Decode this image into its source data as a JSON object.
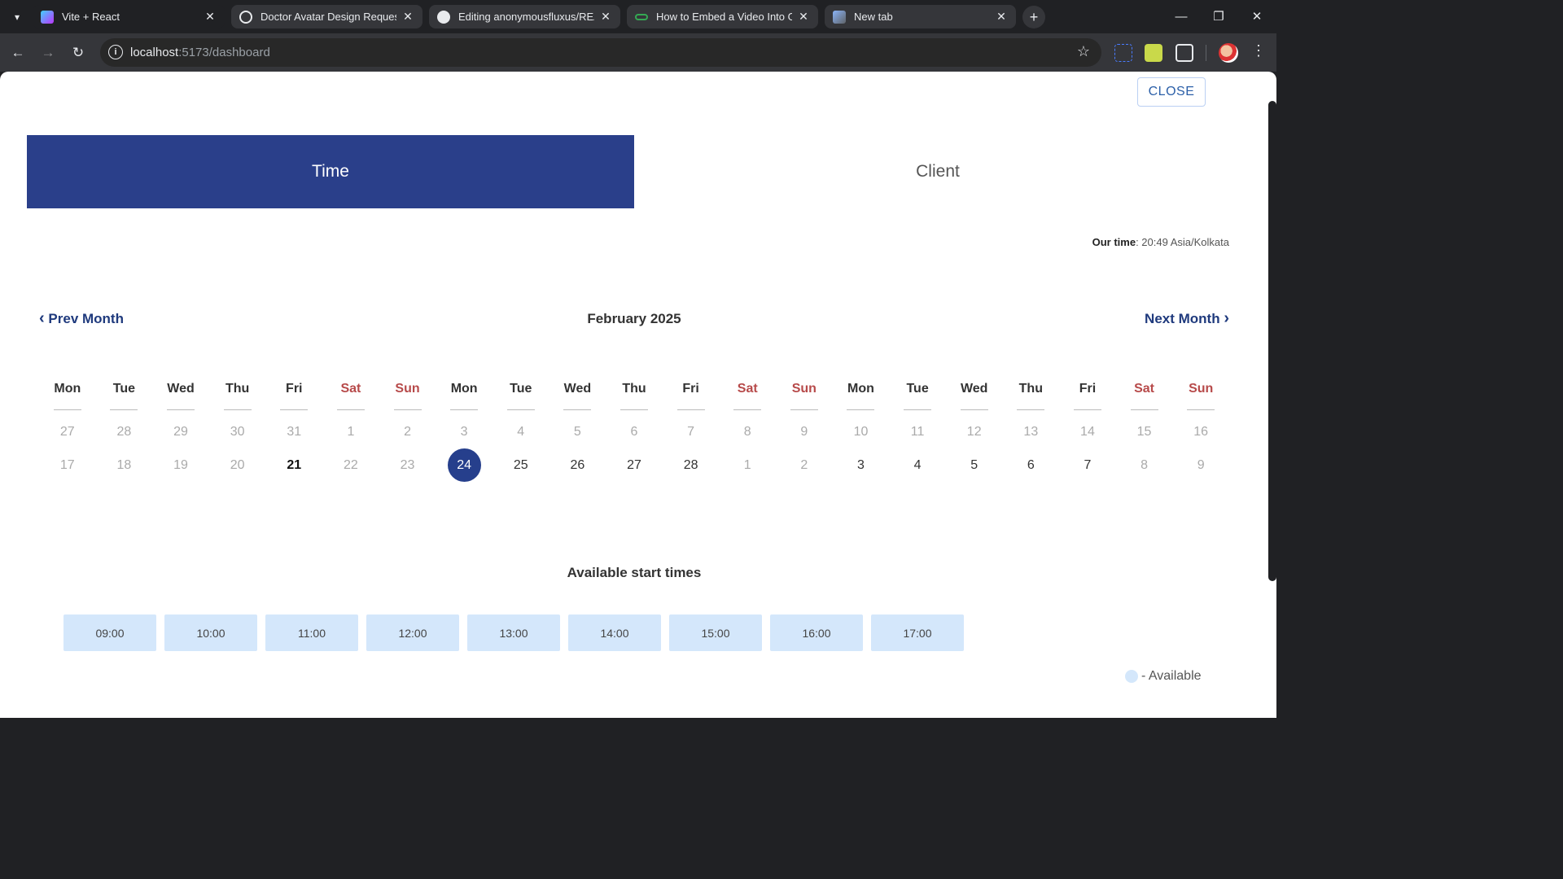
{
  "browser": {
    "tabs": [
      {
        "title": "Vite + React",
        "favicon": "vite-logo-icon",
        "active": true
      },
      {
        "title": "Doctor Avatar Design Request",
        "favicon": "chatgpt-logo-icon",
        "active": false
      },
      {
        "title": "Editing anonymousfluxus/READ",
        "favicon": "github-logo-icon",
        "active": false
      },
      {
        "title": "How to Embed a Video Into Git",
        "favicon": "link-icon",
        "active": false
      },
      {
        "title": "New tab",
        "favicon": "chrome-newtab-icon",
        "active": false
      }
    ],
    "url_host": "localhost",
    "url_path": ":5173/dashboard"
  },
  "page": {
    "close_label": "CLOSE",
    "segments": {
      "time": "Time",
      "client": "Client"
    },
    "our_time_label": "Our time",
    "our_time_value": ": 20:49 Asia/Kolkata",
    "prev_month": "Prev Month",
    "next_month": "Next Month",
    "month_title": "February 2025",
    "weekdays": [
      "Mon",
      "Tue",
      "Wed",
      "Thu",
      "Fri",
      "Sat",
      "Sun",
      "Mon",
      "Tue",
      "Wed",
      "Thu",
      "Fri",
      "Sat",
      "Sun",
      "Mon",
      "Tue",
      "Wed",
      "Thu",
      "Fri",
      "Sat",
      "Sun"
    ],
    "week1": [
      "27",
      "28",
      "29",
      "30",
      "31",
      "1",
      "2",
      "3",
      "4",
      "5",
      "6",
      "7",
      "8",
      "9",
      "10",
      "11",
      "12",
      "13",
      "14",
      "15",
      "16"
    ],
    "week2": [
      "17",
      "18",
      "19",
      "20",
      "21",
      "22",
      "23",
      "24",
      "25",
      "26",
      "27",
      "28",
      "1",
      "2",
      "3",
      "4",
      "5",
      "6",
      "7",
      "8",
      "9"
    ],
    "available_title": "Available start times",
    "slots": [
      "09:00",
      "10:00",
      "11:00",
      "12:00",
      "13:00",
      "14:00",
      "15:00",
      "16:00",
      "17:00"
    ],
    "legend_label": "- Available",
    "colors": {
      "primary": "#2a3f8a",
      "available": "#d4e7fb",
      "weekend": "#b74a4a"
    }
  }
}
